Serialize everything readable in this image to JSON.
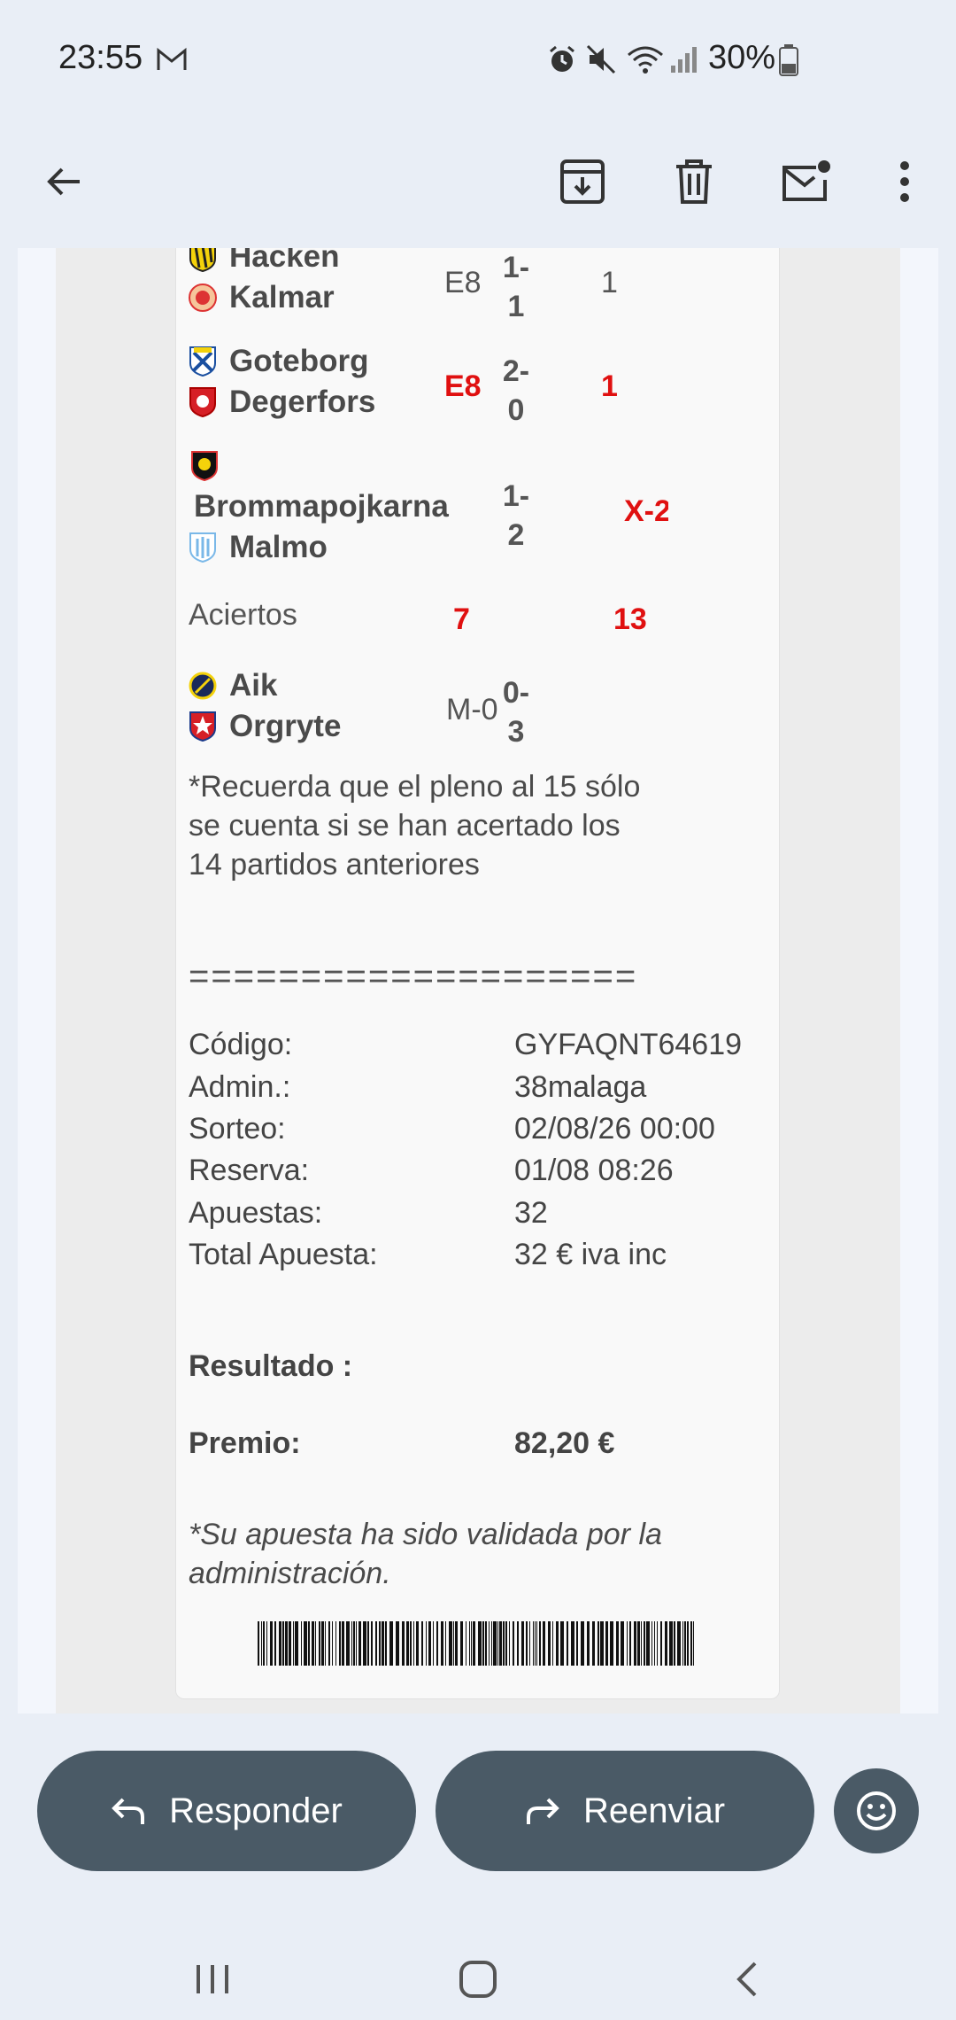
{
  "status_bar": {
    "time": "23:55",
    "battery": "30%"
  },
  "matches": [
    {
      "home": "Hacken",
      "away": "Kalmar",
      "score_top": "1-",
      "score_bottom": "1",
      "pick1": "E8",
      "pick2": "1",
      "pick_red": false
    },
    {
      "home": "Goteborg",
      "away": "Degerfors",
      "score_top": "2-",
      "score_bottom": "0",
      "pick1": "E8",
      "pick2": "1",
      "pick_red": true
    },
    {
      "home": "Brommapojkarna",
      "away": "Malmo",
      "score_top": "1-",
      "score_bottom": "2",
      "pick1": "",
      "pick2": "X-2",
      "pick_red": true
    }
  ],
  "aciertos": {
    "label": "Aciertos",
    "v1": "7",
    "v2": "13"
  },
  "pleno": {
    "home": "Aik",
    "away": "Orgryte",
    "score_top": "0-",
    "score_bottom": "3",
    "pick": "M-0"
  },
  "note": "*Recuerda que el pleno al 15 sólo se cuenta si se han acertado los 14 partidos anteriores",
  "separator": "====================",
  "details": [
    {
      "label": "Código:",
      "value": "GYFAQNT64619"
    },
    {
      "label": "Admin.:",
      "value": "38malaga"
    },
    {
      "label": "Sorteo:",
      "value": "02/08/26 00:00"
    },
    {
      "label": "Reserva:",
      "value": "01/08 08:26"
    },
    {
      "label": "Apuestas:",
      "value": "32"
    },
    {
      "label": "Total Apuesta:",
      "value": "32 € iva inc"
    }
  ],
  "resultado_label": "Resultado :",
  "premio": {
    "label": "Premio:",
    "value": "82,20 €"
  },
  "validated": "*Su apuesta ha sido validada por la administración.",
  "actions": {
    "reply": "Responder",
    "forward": "Reenviar"
  }
}
